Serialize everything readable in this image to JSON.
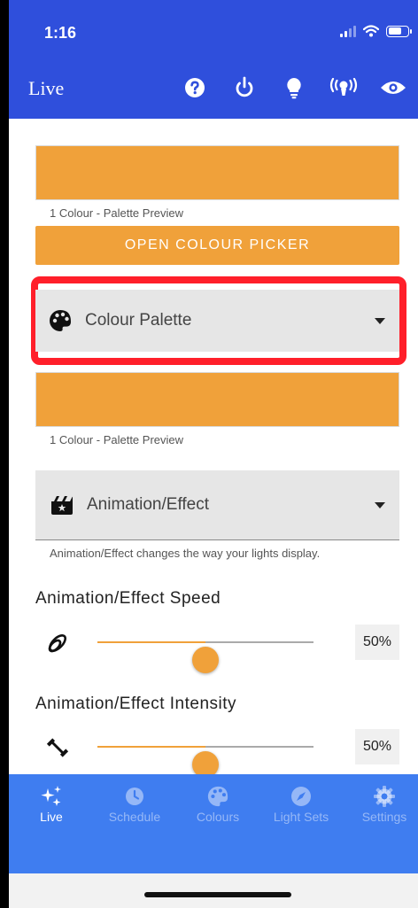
{
  "status": {
    "time": "1:16"
  },
  "header": {
    "title": "Live"
  },
  "palette_preview_1": {
    "caption": "1 Colour - Palette Preview",
    "color": "#f0a13a"
  },
  "picker_button": {
    "label": "OPEN COLOUR PICKER"
  },
  "palette_select": {
    "label": "Colour Palette"
  },
  "palette_preview_2": {
    "caption": "1 Colour - Palette Preview",
    "color": "#f0a13a"
  },
  "effect_select": {
    "label": "Animation/Effect",
    "helper": "Animation/Effect changes the way your lights display."
  },
  "speed": {
    "title": "Animation/Effect Speed",
    "value": "50%",
    "level": 0.5
  },
  "intensity": {
    "title": "Animation/Effect Intensity",
    "value": "50%",
    "level": 0.5
  },
  "tabs": [
    {
      "label": "Live",
      "icon": "sparkles-icon",
      "active": true
    },
    {
      "label": "Schedule",
      "icon": "clock-icon",
      "active": false
    },
    {
      "label": "Colours",
      "icon": "palette-icon",
      "active": false
    },
    {
      "label": "Light Sets",
      "icon": "compass-icon",
      "active": false
    },
    {
      "label": "Settings",
      "icon": "gear-icon",
      "active": false
    }
  ],
  "colors": {
    "header": "#2f4fdc",
    "accent": "#f0a13a",
    "tabbar": "#3f7df0",
    "highlight": "#ff1f2a"
  }
}
